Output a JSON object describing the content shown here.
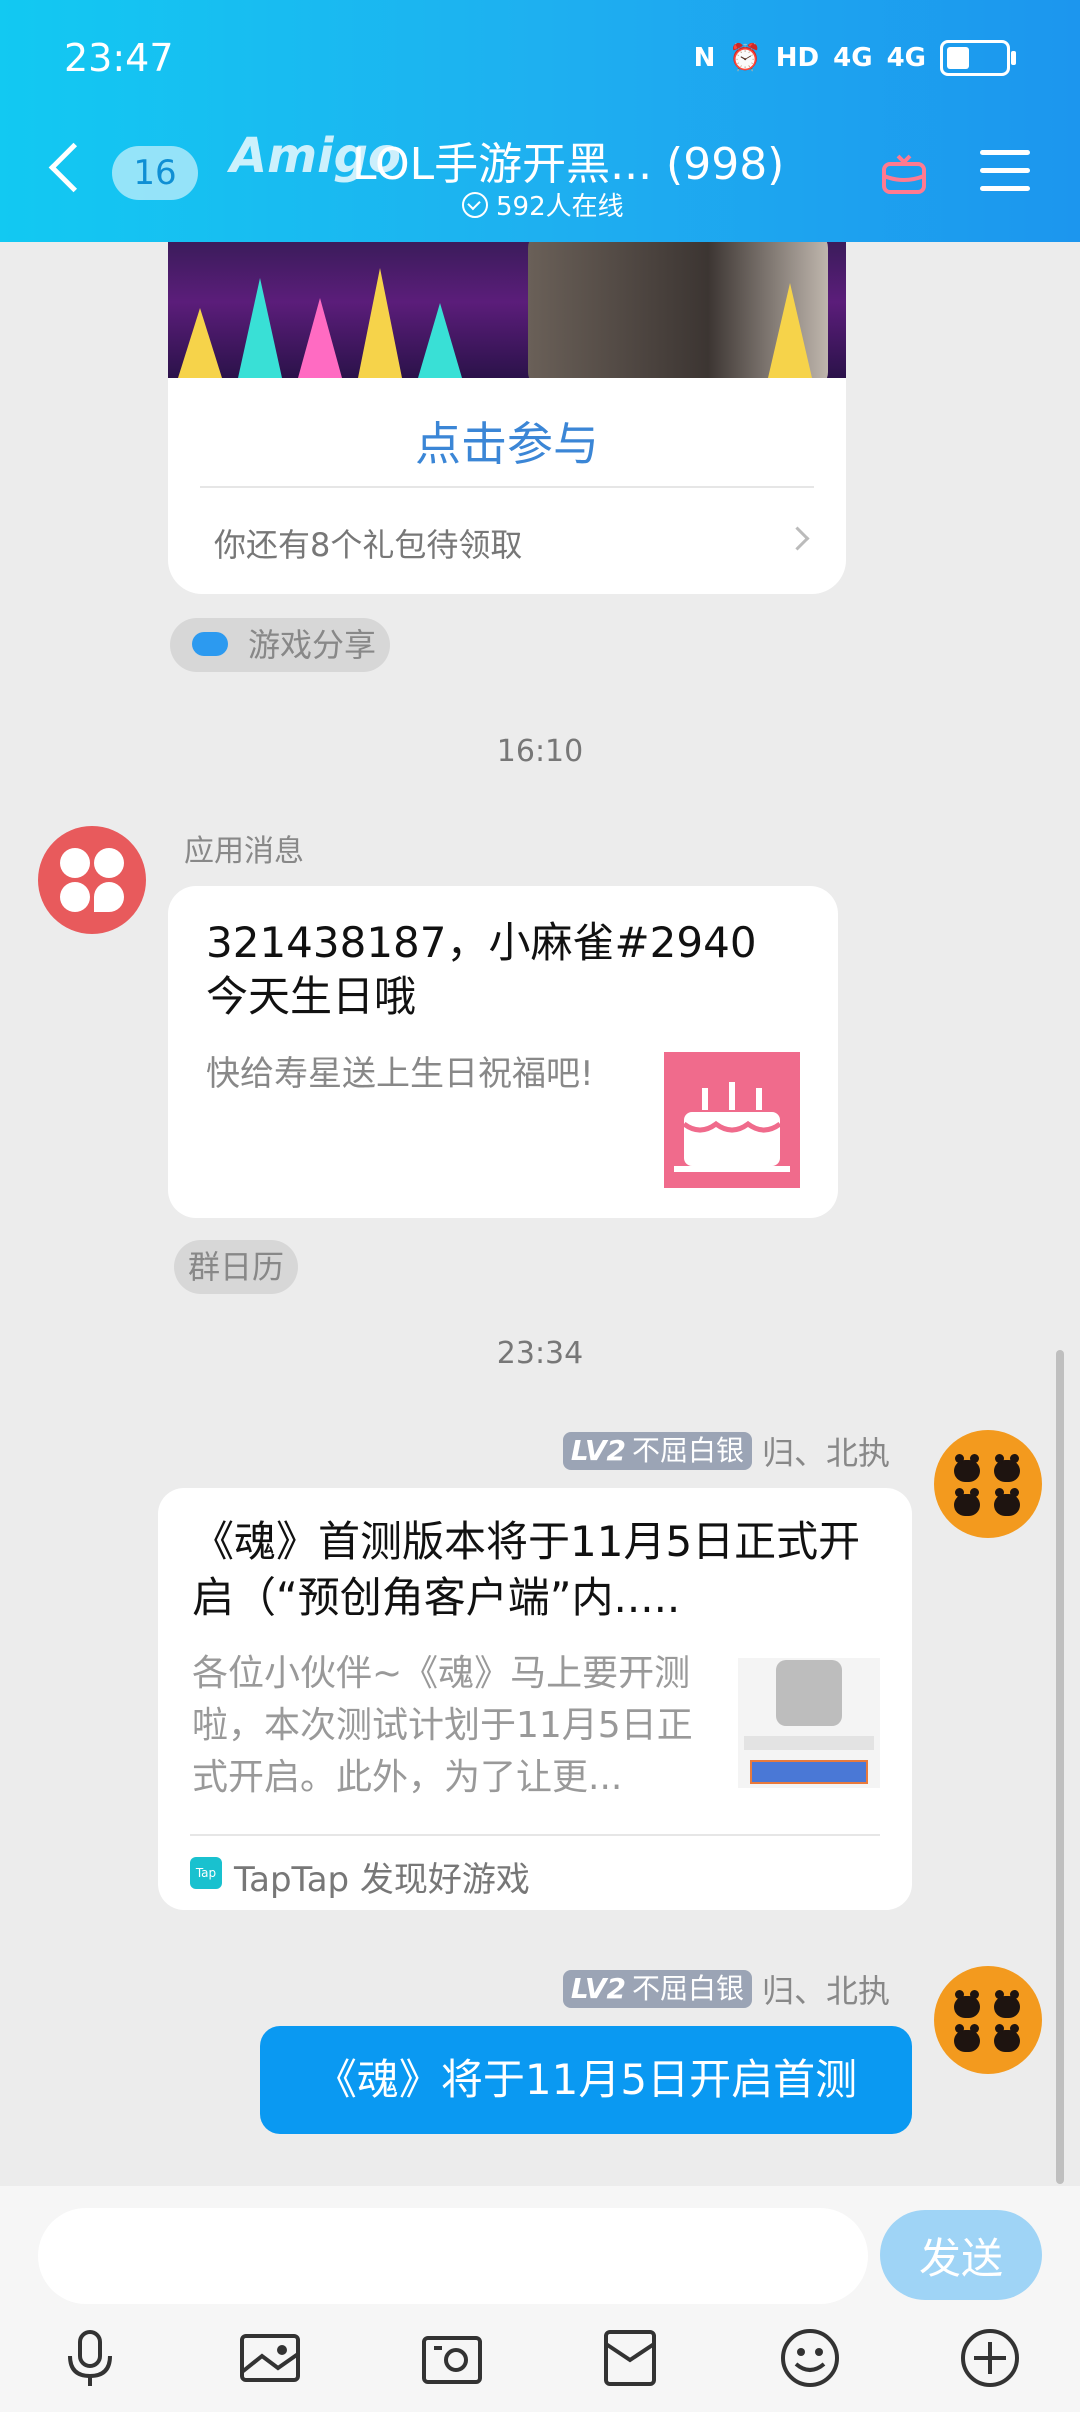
{
  "status_bar": {
    "time": "23:47",
    "network_1": "4G",
    "network_2": "4G",
    "hd": "HD"
  },
  "header": {
    "unread_count": "16",
    "brand": "Amigo",
    "title": "LOL手游开黑... (998)",
    "online": "592人在线"
  },
  "messages": {
    "join_label": "点击参与",
    "gift_notice": "你还有8个礼包待领取",
    "game_share_tag": "游戏分享",
    "time_1": "16:10",
    "app_sender": "应用消息",
    "birthday_title": "321438187，小麻雀#2940今天生日哦",
    "birthday_subtitle": "快给寿星送上生日祝福吧!",
    "calendar_tag": "群日历",
    "time_2": "23:34",
    "sender_level": "LV2",
    "sender_rank": "不屈白银",
    "sender_name": "归、北执",
    "share_title": "《魂》首测版本将于11月5日正式开启（“预创角客户端”内.....",
    "share_desc": "各位小伙伴~《魂》马上要开测啦，本次测试计划于11月5日正式开启。此外，为了让更...",
    "share_source": "TapTap 发现好游戏",
    "tap_logo_text": "Tap",
    "my_message": "《魂》将于11月5日开启首测"
  },
  "composer": {
    "placeholder": "",
    "send_label": "发送"
  },
  "colors": {
    "header_start": "#12c9f2",
    "header_end": "#1c96ee",
    "bubble_self": "#0a99f2",
    "link": "#3b86d6",
    "app_avatar": "#e85a5c"
  }
}
